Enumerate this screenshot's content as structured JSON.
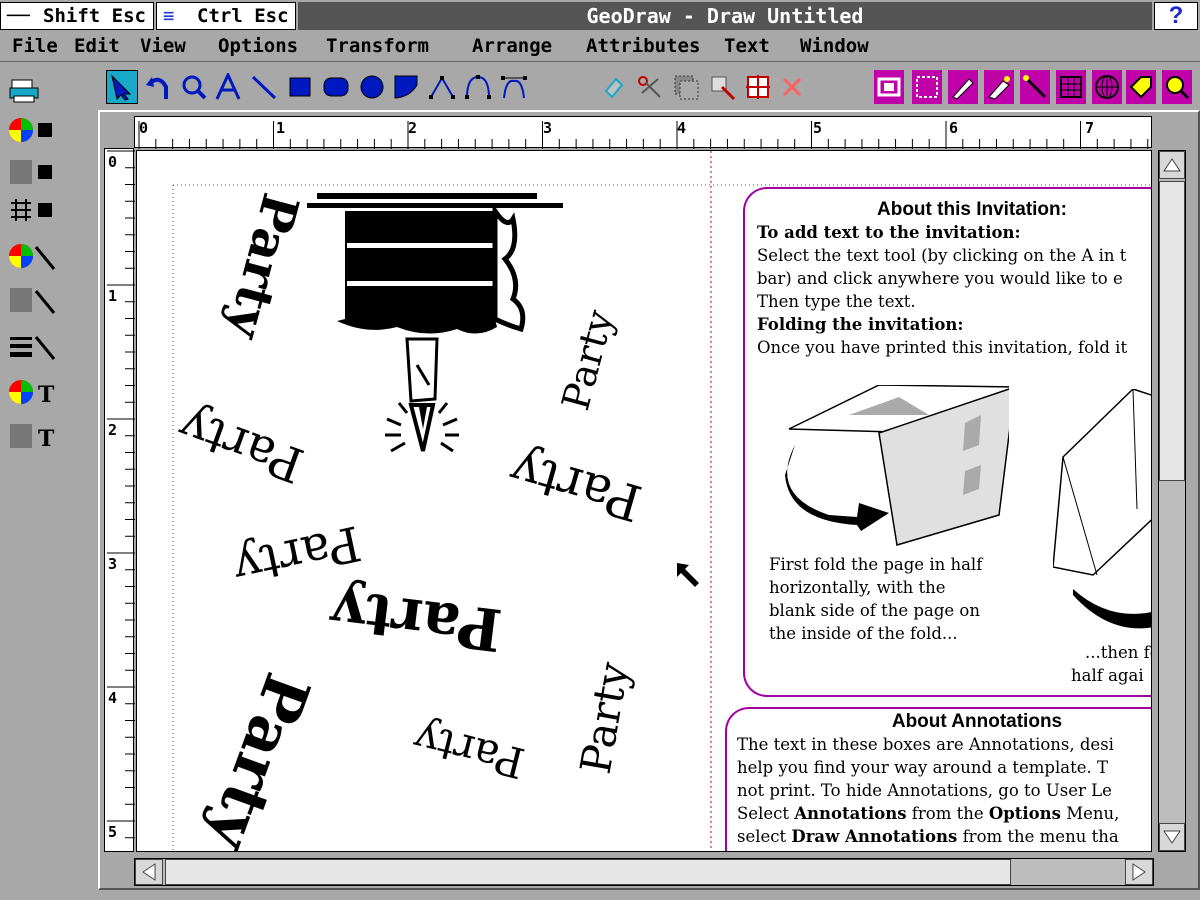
{
  "titlebar": {
    "shift_esc": "Shift Esc",
    "ctrl_esc": "Ctrl Esc",
    "title": "GeoDraw - Draw Untitled",
    "help": "?"
  },
  "menu": [
    "File",
    "Edit",
    "View",
    "Options",
    "Transform",
    "Arrange",
    "Attributes",
    "Text",
    "Window"
  ],
  "toolbar": {
    "tools": [
      "pointer-icon",
      "rotate-icon",
      "zoom-icon",
      "text-tool-icon",
      "line-tool-icon",
      "rectangle-tool-icon",
      "rounded-rect-tool-icon",
      "ellipse-tool-icon",
      "arc-tool-icon",
      "polyline-tool-icon",
      "spline-tool-icon",
      "bezier-tool-icon"
    ],
    "selected_tool": "pointer-icon",
    "edit_tools": [
      "duplicate-icon",
      "cut-icon",
      "copy-icon",
      "paste-icon",
      "align-icon",
      "delete-icon"
    ],
    "view_tools": [
      "frame-icon",
      "marquee-icon",
      "pen-icon",
      "brush-icon",
      "pencil-icon",
      "grid-icon",
      "globe-icon",
      "tag-icon",
      "search-icon"
    ],
    "accent": "#19a8c8",
    "magenta": "#c000a8"
  },
  "palette": [
    "printer-icon",
    "fill-color-icon",
    "fill-pattern-icon",
    "fill-style-icon",
    "line-color-icon",
    "line-pattern-icon",
    "line-width-icon",
    "text-color-icon",
    "text-pattern-icon"
  ],
  "ruler": {
    "h_labels": [
      "0",
      "1",
      "2",
      "3",
      "4",
      "5",
      "6",
      "7"
    ],
    "v_labels": [
      "0",
      "1",
      "2",
      "3",
      "4",
      "5"
    ]
  },
  "canvas": {
    "party_text": "Party",
    "annotation1": {
      "title": "About this Invitation:",
      "heading1": "To add text to the invitation:",
      "body1": [
        "Select the text tool (by clicking on the A in t",
        "bar) and click anywhere you would like to e",
        "Then type the text."
      ],
      "heading2": "Folding the invitation:",
      "body2": "Once you have printed this invitation, fold it",
      "caption1": [
        "First fold the page in half",
        "horizontally, with the",
        "blank side of the page on",
        "the inside of the fold..."
      ],
      "caption2": [
        "...then fo",
        "half agai"
      ]
    },
    "annotation2": {
      "title": "About Annotations",
      "lines": [
        [
          "The text in these boxes are Annotations, desi",
          ""
        ],
        [
          "help you find your way around a template. T",
          ""
        ],
        [
          "not print. To hide Annotations, go to User Le",
          ""
        ]
      ],
      "line4_pre": "Select ",
      "line4_bold1": "Annotations",
      "line4_mid": " from the ",
      "line4_bold2": "Options",
      "line4_post": " Menu,",
      "line5_pre": "select ",
      "line5_bold": "Draw Annotations",
      "line5_post": " from the menu tha"
    },
    "annotation_color": "#a000a0"
  }
}
